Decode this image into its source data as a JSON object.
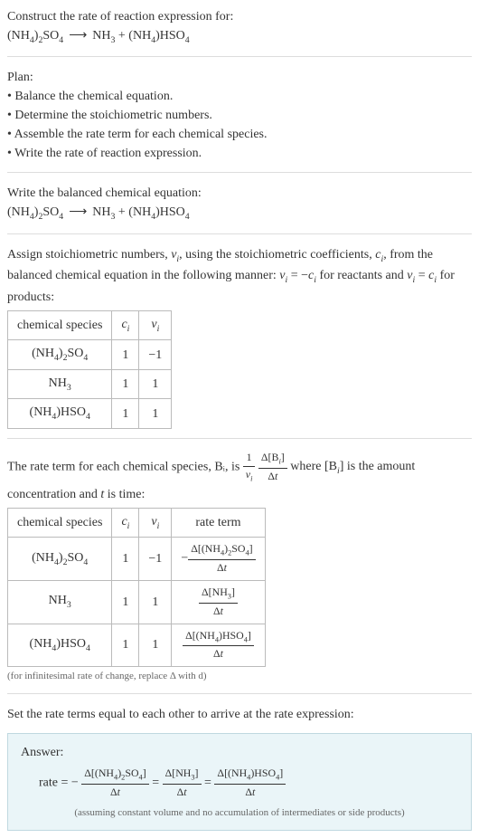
{
  "intro": "Construct the rate of reaction expression for:",
  "equation_unbalanced": "(NH₄)₂SO₄ ⟶ NH₃ + (NH₄)HSO₄",
  "plan_title": "Plan:",
  "plan_items": [
    "• Balance the chemical equation.",
    "• Determine the stoichiometric numbers.",
    "• Assemble the rate term for each chemical species.",
    "• Write the rate of reaction expression."
  ],
  "balanced_intro": "Write the balanced chemical equation:",
  "equation_balanced": "(NH₄)₂SO₄ ⟶ NH₃ + (NH₄)HSO₄",
  "stoich_intro": "Assign stoichiometric numbers, νᵢ, using the stoichiometric coefficients, cᵢ, from the balanced chemical equation in the following manner: νᵢ = −cᵢ for reactants and νᵢ = cᵢ for products:",
  "table1": {
    "headers": [
      "chemical species",
      "cᵢ",
      "νᵢ"
    ],
    "rows": [
      {
        "species": "(NH₄)₂SO₄",
        "ci": "1",
        "vi": "−1"
      },
      {
        "species": "NH₃",
        "ci": "1",
        "vi": "1"
      },
      {
        "species": "(NH₄)HSO₄",
        "ci": "1",
        "vi": "1"
      }
    ]
  },
  "rate_term_intro_a": "The rate term for each chemical species, Bᵢ, is ",
  "rate_term_intro_b": " where [Bᵢ] is the amount concentration and t is time:",
  "rate_frac": {
    "num1": "1",
    "den1": "νᵢ",
    "num2": "Δ[Bᵢ]",
    "den2": "Δt"
  },
  "table2": {
    "headers": [
      "chemical species",
      "cᵢ",
      "νᵢ",
      "rate term"
    ],
    "rows": [
      {
        "species": "(NH₄)₂SO₄",
        "ci": "1",
        "vi": "−1",
        "rt_neg": "−",
        "rt_num": "Δ[(NH₄)₂SO₄]",
        "rt_den": "Δt"
      },
      {
        "species": "NH₃",
        "ci": "1",
        "vi": "1",
        "rt_neg": "",
        "rt_num": "Δ[NH₃]",
        "rt_den": "Δt"
      },
      {
        "species": "(NH₄)HSO₄",
        "ci": "1",
        "vi": "1",
        "rt_neg": "",
        "rt_num": "Δ[(NH₄)HSO₄]",
        "rt_den": "Δt"
      },
      {
        "species": "—note—",
        "ci": "",
        "vi": "",
        "rt_neg": "",
        "rt_num": "",
        "rt_den": ""
      }
    ],
    "note": "(for infinitesimal rate of change, replace Δ with d)"
  },
  "set_equal": "Set the rate terms equal to each other to arrive at the rate expression:",
  "answer_label": "Answer:",
  "answer_prefix": "rate = −",
  "answer_terms": [
    {
      "num": "Δ[(NH₄)₂SO₄]",
      "den": "Δt"
    },
    {
      "num": "Δ[NH₃]",
      "den": "Δt"
    },
    {
      "num": "Δ[(NH₄)HSO₄]",
      "den": "Δt"
    }
  ],
  "answer_eq": " = ",
  "answer_note": "(assuming constant volume and no accumulation of intermediates or side products)"
}
